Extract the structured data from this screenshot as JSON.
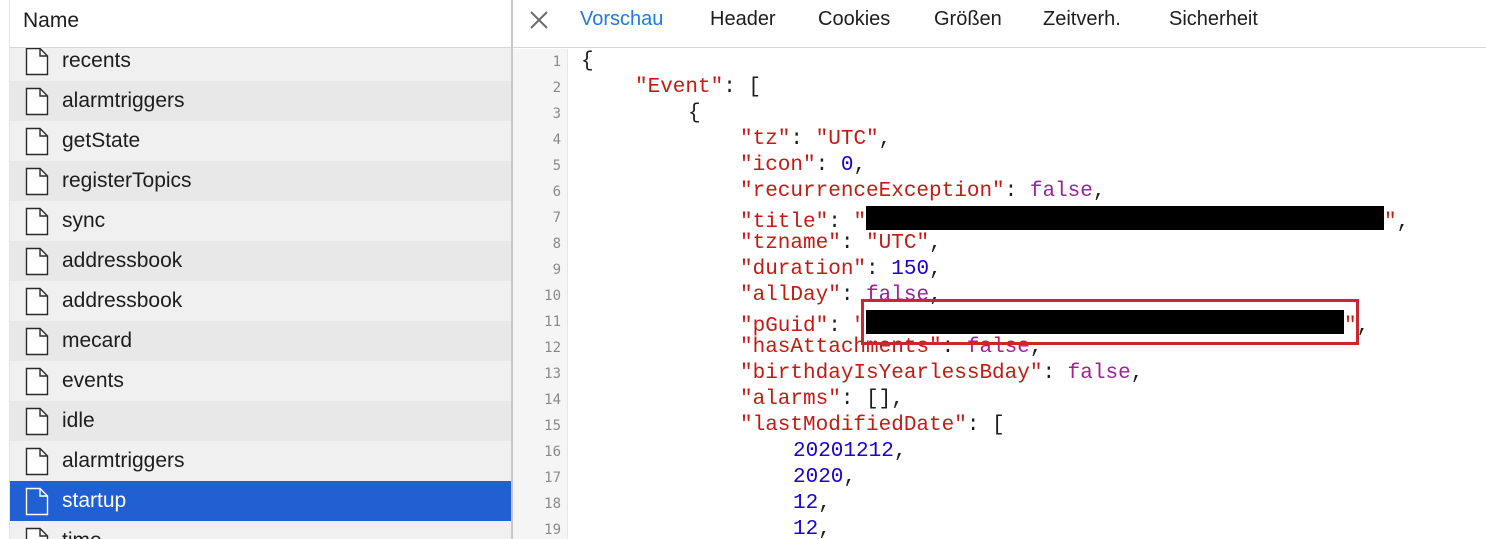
{
  "list": {
    "header": "Name",
    "items": [
      {
        "name": "recents",
        "selected": false
      },
      {
        "name": "alarmtriggers",
        "selected": false
      },
      {
        "name": "getState",
        "selected": false
      },
      {
        "name": "registerTopics",
        "selected": false
      },
      {
        "name": "sync",
        "selected": false
      },
      {
        "name": "addressbook",
        "selected": false
      },
      {
        "name": "addressbook",
        "selected": false
      },
      {
        "name": "mecard",
        "selected": false
      },
      {
        "name": "events",
        "selected": false
      },
      {
        "name": "idle",
        "selected": false
      },
      {
        "name": "alarmtriggers",
        "selected": false
      },
      {
        "name": "startup",
        "selected": true
      },
      {
        "name": "time",
        "selected": false
      }
    ],
    "item_icon": "document-icon",
    "selected_color": "#2160d2"
  },
  "tabs": {
    "close_icon": "close-icon",
    "items": [
      {
        "label": "Vorschau",
        "active": true
      },
      {
        "label": "Header",
        "active": false
      },
      {
        "label": "Cookies",
        "active": false
      },
      {
        "label": "Größen",
        "active": false
      },
      {
        "label": "Zeitverh.",
        "active": false
      },
      {
        "label": "Sicherheit",
        "active": false
      }
    ],
    "active_color": "#1f7ae0"
  },
  "preview": {
    "lines": [
      {
        "no": "1",
        "indent": 0,
        "parts": [
          [
            "p",
            "{"
          ]
        ]
      },
      {
        "no": "2",
        "indent": 1,
        "parts": [
          [
            "k",
            "\"Event\""
          ],
          [
            "p",
            ": ["
          ]
        ]
      },
      {
        "no": "3",
        "indent": 2,
        "parts": [
          [
            "p",
            "{"
          ]
        ]
      },
      {
        "no": "4",
        "indent": 3,
        "parts": [
          [
            "k",
            "\"tz\""
          ],
          [
            "p",
            ": "
          ],
          [
            "s",
            "\"UTC\""
          ],
          [
            "p",
            ","
          ]
        ]
      },
      {
        "no": "5",
        "indent": 3,
        "parts": [
          [
            "k",
            "\"icon\""
          ],
          [
            "p",
            ": "
          ],
          [
            "n",
            "0"
          ],
          [
            "p",
            ","
          ]
        ]
      },
      {
        "no": "6",
        "indent": 3,
        "parts": [
          [
            "k",
            "\"recurrenceException\""
          ],
          [
            "p",
            ": "
          ],
          [
            "b",
            "false"
          ],
          [
            "p",
            ","
          ]
        ]
      },
      {
        "no": "7",
        "indent": 3,
        "parts": [
          [
            "k",
            "\"title\""
          ],
          [
            "p",
            ": "
          ],
          [
            "s",
            "\""
          ],
          [
            "redact",
            "title"
          ],
          [
            "s",
            "\""
          ],
          [
            "p",
            ","
          ]
        ]
      },
      {
        "no": "8",
        "indent": 3,
        "parts": [
          [
            "k",
            "\"tzname\""
          ],
          [
            "p",
            ": "
          ],
          [
            "s",
            "\"UTC\""
          ],
          [
            "p",
            ","
          ]
        ]
      },
      {
        "no": "9",
        "indent": 3,
        "parts": [
          [
            "k",
            "\"duration\""
          ],
          [
            "p",
            ": "
          ],
          [
            "n",
            "150"
          ],
          [
            "p",
            ","
          ]
        ]
      },
      {
        "no": "10",
        "indent": 3,
        "parts": [
          [
            "k",
            "\"allDay\""
          ],
          [
            "p",
            ": "
          ],
          [
            "b",
            "false"
          ],
          [
            "p",
            ","
          ]
        ]
      },
      {
        "no": "11",
        "indent": 3,
        "parts": [
          [
            "k",
            "\"pGuid\""
          ],
          [
            "p",
            ": "
          ],
          [
            "s",
            "\""
          ],
          [
            "redact",
            "pguid"
          ],
          [
            "s",
            "\""
          ],
          [
            "p",
            ","
          ]
        ]
      },
      {
        "no": "12",
        "indent": 3,
        "parts": [
          [
            "k",
            "\"hasAttachments\""
          ],
          [
            "p",
            ": "
          ],
          [
            "b",
            "false"
          ],
          [
            "p",
            ","
          ]
        ]
      },
      {
        "no": "13",
        "indent": 3,
        "parts": [
          [
            "k",
            "\"birthdayIsYearlessBday\""
          ],
          [
            "p",
            ": "
          ],
          [
            "b",
            "false"
          ],
          [
            "p",
            ","
          ]
        ]
      },
      {
        "no": "14",
        "indent": 3,
        "parts": [
          [
            "k",
            "\"alarms\""
          ],
          [
            "p",
            ": [],"
          ]
        ]
      },
      {
        "no": "15",
        "indent": 3,
        "parts": [
          [
            "k",
            "\"lastModifiedDate\""
          ],
          [
            "p",
            ": ["
          ]
        ]
      },
      {
        "no": "16",
        "indent": 4,
        "parts": [
          [
            "n",
            "20201212"
          ],
          [
            "p",
            ","
          ]
        ]
      },
      {
        "no": "17",
        "indent": 4,
        "parts": [
          [
            "n",
            "2020"
          ],
          [
            "p",
            ","
          ]
        ]
      },
      {
        "no": "18",
        "indent": 4,
        "parts": [
          [
            "n",
            "12"
          ],
          [
            "p",
            ","
          ]
        ]
      },
      {
        "no": "19",
        "indent": 4,
        "parts": [
          [
            "n",
            "12"
          ],
          [
            "p",
            ","
          ]
        ]
      }
    ],
    "highlight_color": "#c8282d",
    "colors": {
      "key": "#c41a16",
      "string": "#c41a16",
      "number": "#1c00cf",
      "boolean": "#9b2393"
    }
  }
}
